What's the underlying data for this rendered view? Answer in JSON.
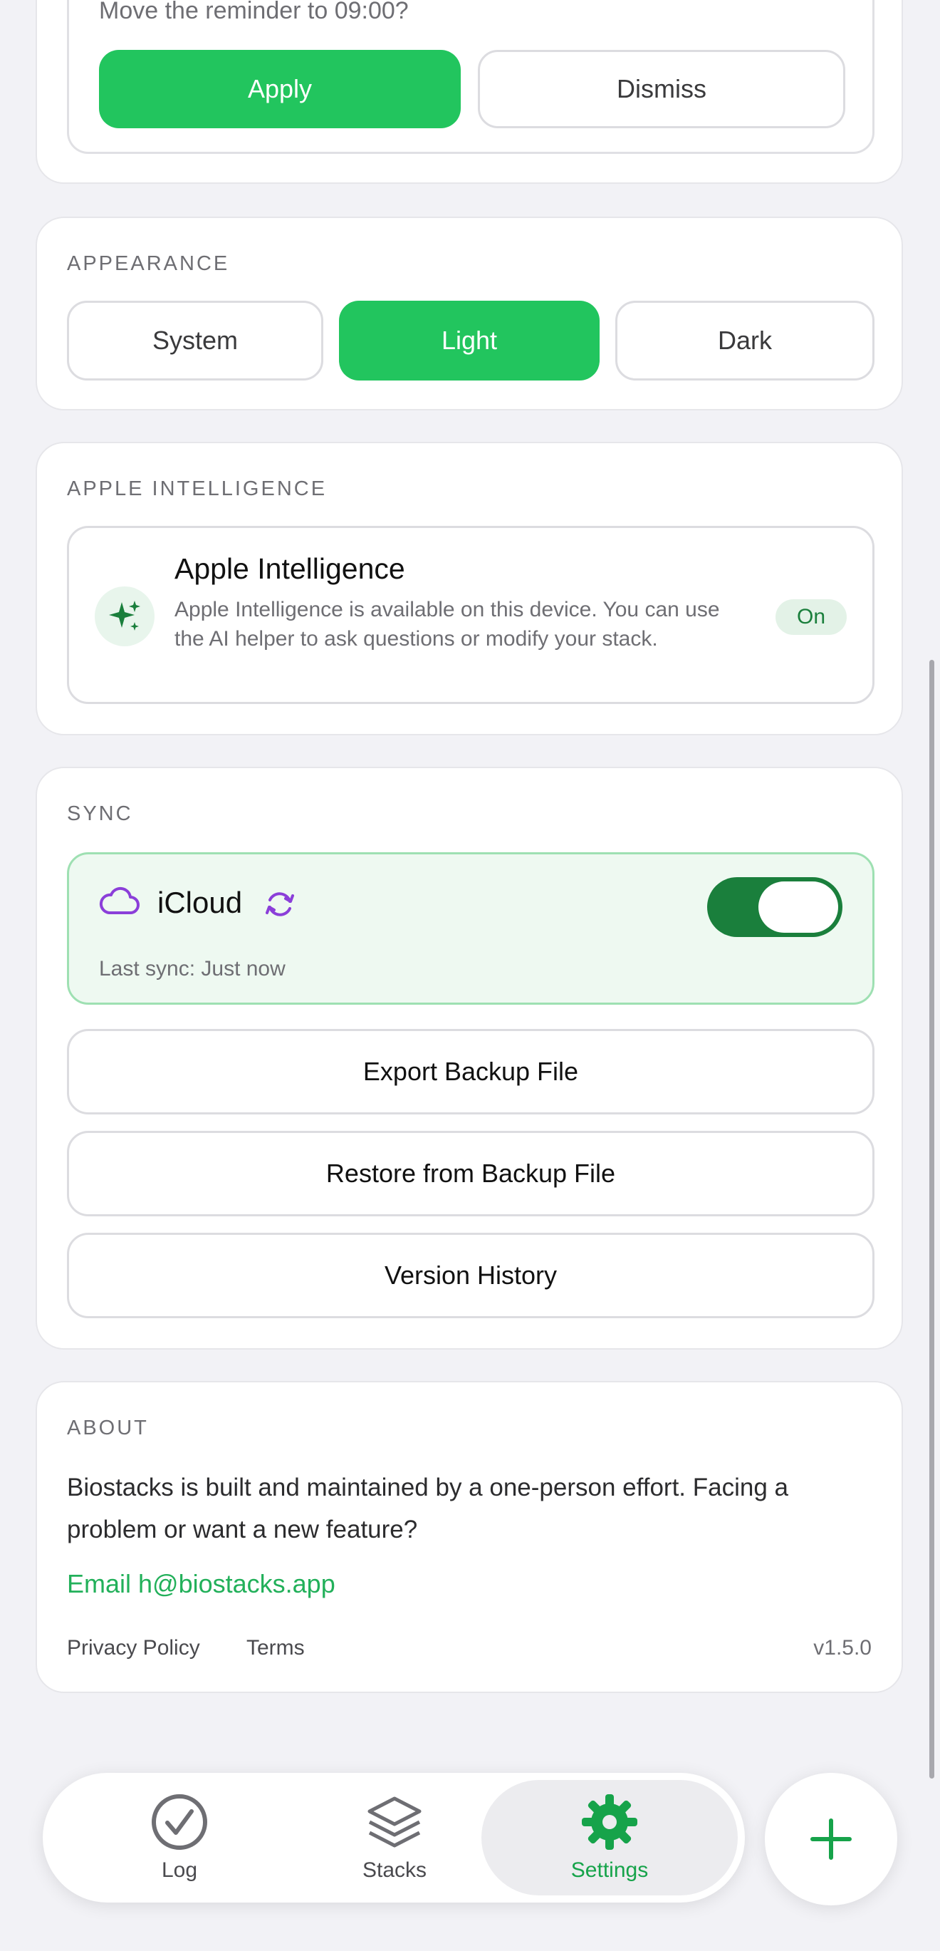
{
  "reminder": {
    "prompt": "Move the reminder to 09:00?",
    "apply_label": "Apply",
    "dismiss_label": "Dismiss"
  },
  "appearance": {
    "section_title": "APPEARANCE",
    "options": [
      "System",
      "Light",
      "Dark"
    ],
    "selected": "Light"
  },
  "apple_intelligence": {
    "section_title": "APPLE INTELLIGENCE",
    "title": "Apple Intelligence",
    "description": "Apple Intelligence is available on this device. You can use the AI helper to ask questions or modify your stack.",
    "status_badge": "On",
    "icon": "sparkles-icon"
  },
  "sync": {
    "section_title": "SYNC",
    "provider": "iCloud",
    "last_sync": "Last sync: Just now",
    "enabled": true,
    "export_label": "Export Backup File",
    "restore_label": "Restore from Backup File",
    "history_label": "Version History"
  },
  "about": {
    "section_title": "ABOUT",
    "text": "Biostacks is built and maintained by a one-person effort. Facing a problem or want a new feature?",
    "email_link": "Email h@biostacks.app",
    "privacy_label": "Privacy Policy",
    "terms_label": "Terms",
    "version": "v1.5.0"
  },
  "tabbar": {
    "tabs": [
      {
        "label": "Log",
        "icon": "checkmark-circle-icon"
      },
      {
        "label": "Stacks",
        "icon": "layers-icon"
      },
      {
        "label": "Settings",
        "icon": "gear-icon"
      }
    ],
    "active": "Settings",
    "add_icon": "plus-icon"
  },
  "colors": {
    "accent": "#22c55e",
    "accent_dark": "#1a7f3c",
    "icloud_purple": "#8b3fd9",
    "sync_bg": "#eef9f1"
  }
}
